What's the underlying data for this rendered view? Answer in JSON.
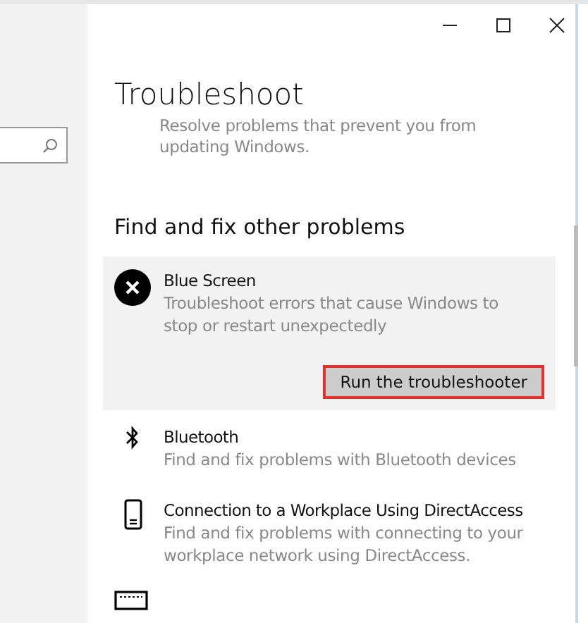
{
  "window": {
    "title": "Troubleshoot"
  },
  "previous_item": {
    "description_lines": [
      "Resolve problems that prevent you from",
      "updating Windows."
    ]
  },
  "section": {
    "heading": "Find and fix other problems"
  },
  "items": [
    {
      "kind": "error",
      "title": "Blue Screen",
      "description_lines": [
        "Troubleshoot errors that cause Windows to",
        "stop or restart unexpectedly"
      ],
      "expanded": true,
      "button": "Run the troubleshooter",
      "highlighted": true
    },
    {
      "kind": "bluetooth",
      "title": "Bluetooth",
      "description_lines": [
        "Find and fix problems with Bluetooth devices"
      ],
      "expanded": false
    },
    {
      "kind": "phone",
      "title": "Connection to a Workplace Using DirectAccess",
      "description_lines": [
        "Find and fix problems with connecting to your",
        "workplace network using DirectAccess."
      ],
      "expanded": false
    }
  ]
}
